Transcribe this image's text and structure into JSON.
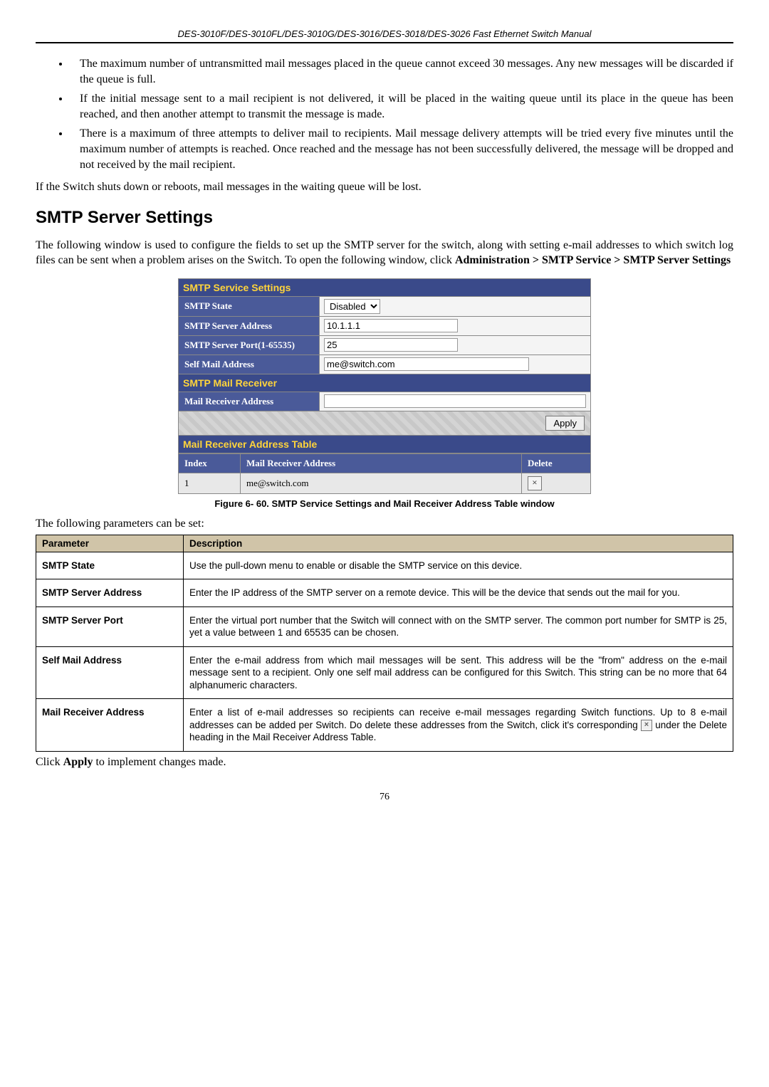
{
  "header": "DES-3010F/DES-3010FL/DES-3010G/DES-3016/DES-3018/DES-3026 Fast Ethernet Switch Manual",
  "bullets": [
    "The maximum number of untransmitted mail messages placed in the queue cannot exceed 30 messages. Any new messages will be discarded if the queue is full.",
    "If the initial message sent to a mail recipient is not delivered, it will be placed in the waiting queue until its place in the queue has been reached, and then another attempt to transmit the message is made.",
    "There is a maximum of three attempts to deliver mail to recipients. Mail message delivery attempts will be tried every five minutes until the maximum number of attempts is reached. Once reached and the message has not been successfully delivered, the message will be dropped and not received by the mail recipient."
  ],
  "after_bullets": "If the Switch shuts down or reboots, mail messages in the waiting queue will be lost.",
  "section_title": "SMTP Server Settings",
  "intro_before_bold": " The following window is used to configure the fields to set up the SMTP server for the switch, along with setting e-mail addresses to which switch log files can be sent when a problem arises on the Switch. To open the following window, click ",
  "breadcrumb": "Administration > SMTP Service > SMTP Server Settings",
  "figure": {
    "hdr1": "SMTP Service Settings",
    "rows": {
      "state_label": "SMTP State",
      "state_value": "Disabled",
      "server_addr_label": "SMTP Server Address",
      "server_addr_value": "10.1.1.1",
      "server_port_label": "SMTP Server Port(1-65535)",
      "server_port_value": "25",
      "self_mail_label": "Self Mail Address",
      "self_mail_value": "me@switch.com"
    },
    "hdr2": "SMTP Mail Receiver",
    "recv_label": "Mail Receiver Address",
    "recv_value": "",
    "apply": "Apply",
    "hdr3": "Mail Receiver Address Table",
    "cols": {
      "c1": "Index",
      "c2": "Mail Receiver Address",
      "c3": "Delete"
    },
    "row1": {
      "idx": "1",
      "addr": "me@switch.com"
    }
  },
  "caption": "Figure 6- 60. SMTP Service Settings and Mail Receiver Address Table window",
  "params_intro": "The following parameters can be set:",
  "params_header": {
    "p": "Parameter",
    "d": "Description"
  },
  "params": [
    {
      "name": "SMTP State",
      "desc": "Use the pull-down menu to enable or disable the SMTP service on this device."
    },
    {
      "name": "SMTP Server Address",
      "desc": "Enter the IP address of the SMTP server on a remote device. This will be the device that sends out the mail for you."
    },
    {
      "name": "SMTP Server Port",
      "desc": "Enter the virtual port number that the Switch will connect with on the SMTP server. The common port number for SMTP is 25, yet a value between 1 and 65535 can be chosen."
    },
    {
      "name": "Self Mail Address",
      "desc": "Enter the e-mail address from which mail messages will be sent. This address will be the \"from\" address on the e-mail message sent to a recipient. Only one self mail address can be configured for this Switch. This string can be no more that 64 alphanumeric characters."
    },
    {
      "name": "Mail Receiver Address",
      "desc_pre": "Enter a list of e-mail addresses so recipients can receive e-mail messages regarding Switch functions. Up to 8 e-mail addresses can be added per Switch. Do delete these addresses from the Switch, click it's corresponding ",
      "desc_post": " under the Delete heading in the Mail Receiver Address Table."
    }
  ],
  "closing_pre": "Click ",
  "closing_bold": "Apply",
  "closing_post": " to implement changes made.",
  "page_num": "76"
}
